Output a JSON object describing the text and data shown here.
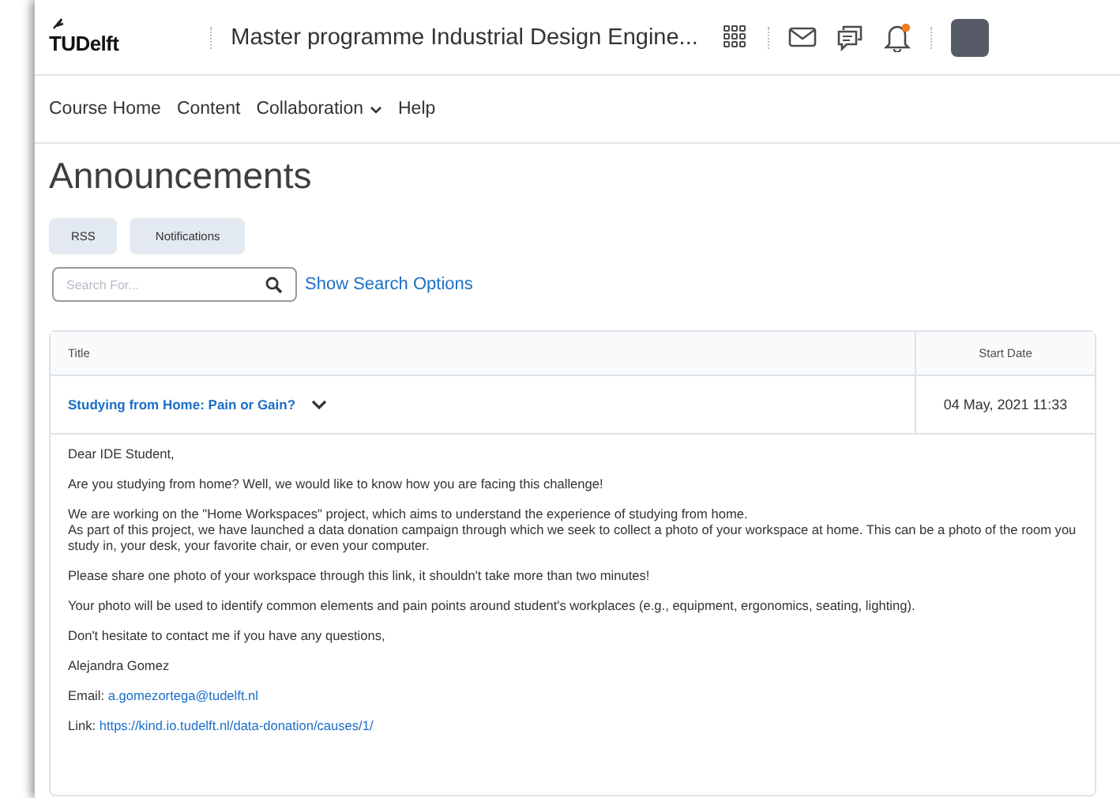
{
  "header": {
    "logo": "TUDelft",
    "course_title": "Master programme Industrial Design Engine...",
    "notification_unread": true
  },
  "nav": [
    {
      "label": "Course Home",
      "dropdown": false
    },
    {
      "label": "Content",
      "dropdown": false
    },
    {
      "label": "Collaboration",
      "dropdown": true
    },
    {
      "label": "Help",
      "dropdown": false
    }
  ],
  "page_title": "Announcements",
  "buttons": [
    "RSS",
    "Notifications"
  ],
  "search": {
    "placeholder": "Search For...",
    "options_link": "Show Search Options"
  },
  "table": {
    "columns": [
      "Title",
      "Start Date"
    ],
    "rows": [
      {
        "title": "Studying from Home: Pain or Gain?",
        "start_date": "04 May, 2021 11:33",
        "expanded": true
      }
    ]
  },
  "announcement_body": [
    {
      "kind": "text",
      "text": "Dear IDE Student,"
    },
    {
      "kind": "text",
      "text": "Are you studying from home? Well, we would like to know how you are facing this challenge!"
    },
    {
      "kind": "lines",
      "lines": [
        "We are working on the \"Home Workspaces\" project, which aims to understand the experience of studying from home.",
        "As part of this project, we have launched a data donation campaign through which we seek to collect a photo of your workspace at home. This can be a photo of the room you study in, your desk, your favorite chair, or even your computer."
      ]
    },
    {
      "kind": "text",
      "text": "Please share one photo of your workspace through this link, it shouldn't take more than two minutes!"
    },
    {
      "kind": "text",
      "text": "Your photo will be used to identify common elements and pain points around student's workplaces (e.g., equipment, ergonomics, seating, lighting)."
    },
    {
      "kind": "text",
      "text": "Don't hesitate to contact me if you have any questions,"
    },
    {
      "kind": "text",
      "text": "Alejandra Gomez"
    },
    {
      "kind": "link",
      "label": "Email:",
      "link": "a.gomezortega@tudelft.nl"
    },
    {
      "kind": "link",
      "label": "Link:",
      "link": "https://kind.io.tudelft.nl/data-donation/causes/1/"
    }
  ]
}
